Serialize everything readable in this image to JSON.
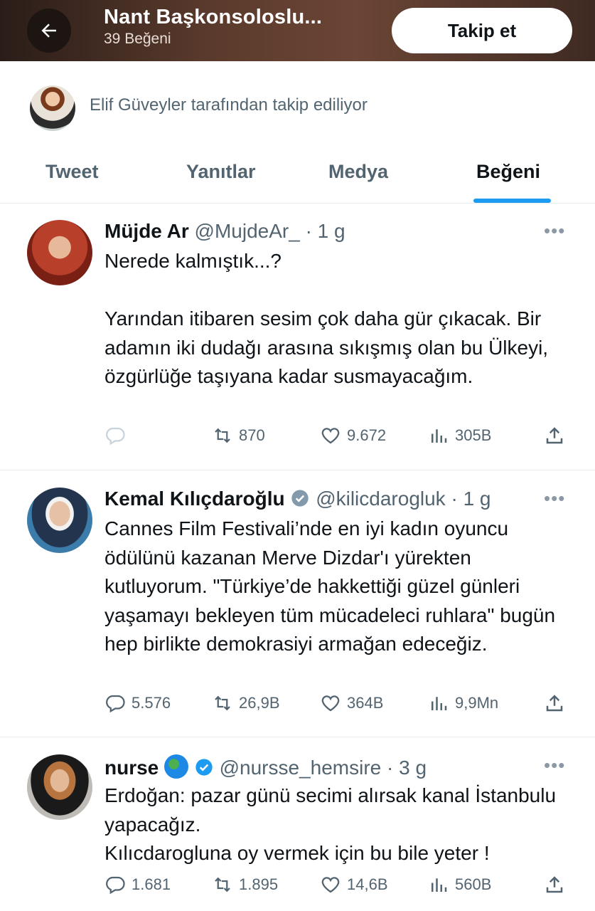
{
  "header": {
    "title": "Nant Başkonsoloslu...",
    "subtitle": "39 Beğeni",
    "follow_label": "Takip et"
  },
  "followed_by": {
    "text": "Elif Güveyler tarafından takip ediliyor"
  },
  "tabs": [
    {
      "label": "Tweet"
    },
    {
      "label": "Yanıtlar"
    },
    {
      "label": "Medya"
    },
    {
      "label": "Beğeni"
    }
  ],
  "colors": {
    "accent": "#1d9bf0",
    "text": "#0f1419",
    "muted": "#536471"
  },
  "tweets": [
    {
      "name": "Müjde Ar",
      "handle": "@MujdeAr_",
      "time": "· 1 g",
      "verified": false,
      "text": "Nerede kalmıştık...?\n\nYarından itibaren sesim çok daha gür çıkacak. Bir adamın iki dudağı arasına sıkışmış olan bu Ülkeyi, özgürlüğe taşıyana kadar susmayacağım.",
      "replies": "",
      "retweets": "870",
      "likes": "9.672",
      "views": "305B"
    },
    {
      "name": "Kemal Kılıçdaroğlu",
      "handle": "@kilicdarogluk",
      "time": "· 1 g",
      "verified": true,
      "text": "Cannes Film Festivali’nde en iyi kadın oyuncu ödülünü kazanan Merve Dizdar'ı yürekten kutluyorum. \"Türkiye’de hakkettiği güzel günleri yaşamayı bekleyen tüm mücadeleci ruhlara\" bugün hep birlikte demokrasiyi armağan edeceğiz.",
      "replies": "5.576",
      "retweets": "26,9B",
      "likes": "364B",
      "views": "9,9Mn"
    },
    {
      "name": "nurse",
      "handle": "@nursse_hemsire",
      "time": "· 3 g",
      "verified": true,
      "text": "Erdoğan: pazar günü secimi alırsak kanal İstanbulu yapacağız.\nKılıcdarogluna oy vermek için bu bile yeter !",
      "replies": "1.681",
      "retweets": "1.895",
      "likes": "14,6B",
      "views": "560B"
    }
  ]
}
